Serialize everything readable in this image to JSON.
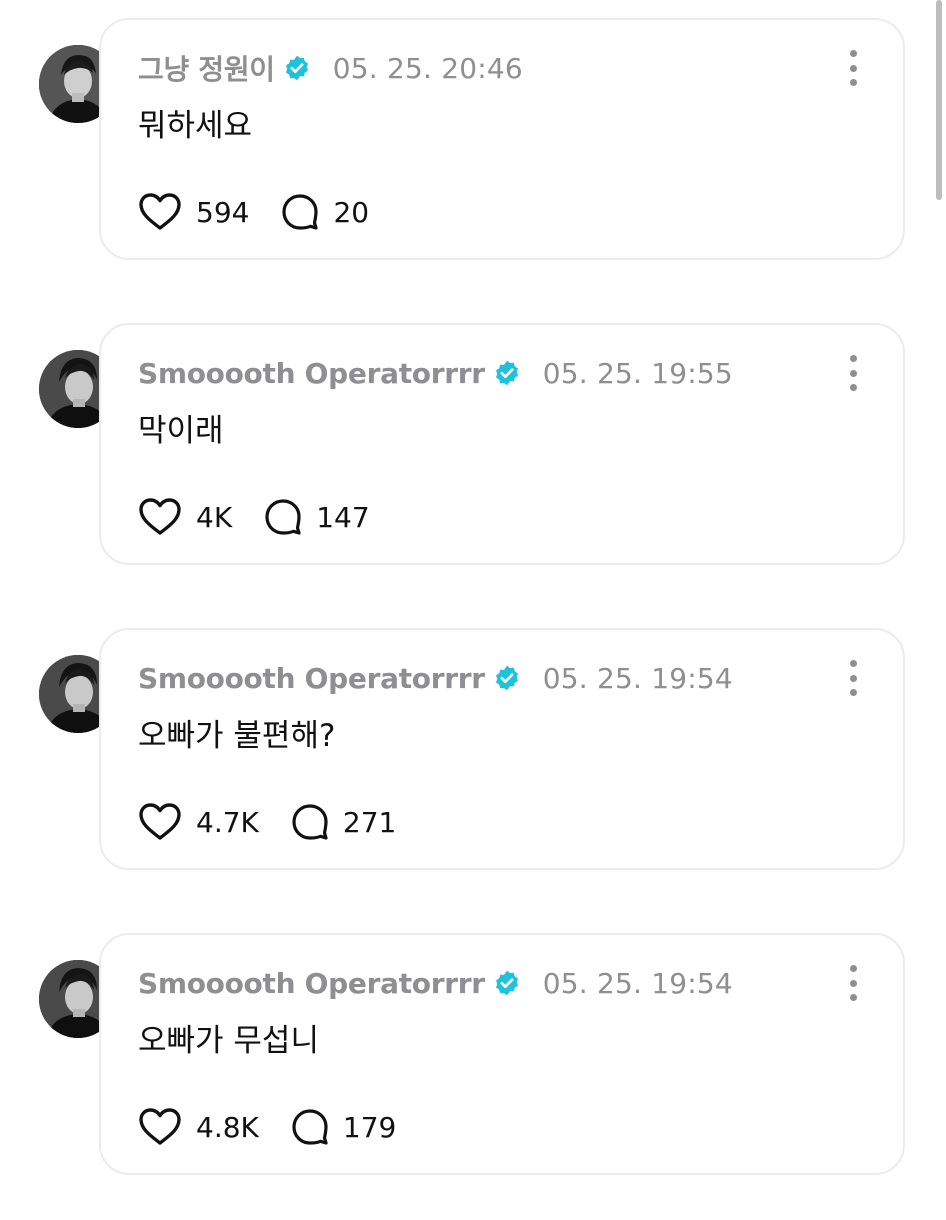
{
  "posts": [
    {
      "author": "그냥 정원이",
      "timestamp": "05. 25. 20:46",
      "text": "뭐하세요",
      "likes": "594",
      "comments": "20"
    },
    {
      "author": "Smooooth Operatorrrr",
      "timestamp": "05. 25. 19:55",
      "text": "막이래",
      "likes": "4K",
      "comments": "147"
    },
    {
      "author": "Smooooth Operatorrrr",
      "timestamp": "05. 25. 19:54",
      "text": "오빠가 불편해?",
      "likes": "4.7K",
      "comments": "271"
    },
    {
      "author": "Smooooth Operatorrrr",
      "timestamp": "05. 25. 19:54",
      "text": "오빠가 무섭니",
      "likes": "4.8K",
      "comments": "179"
    }
  ],
  "icons": {
    "verified": "verified-badge-icon",
    "like": "heart-icon",
    "comment": "speech-bubble-icon",
    "menu": "more-vertical-icon"
  },
  "colors": {
    "verified_badge": "#1fc2dd",
    "muted_text": "#8e8e93",
    "bubble_border": "#ececee"
  }
}
